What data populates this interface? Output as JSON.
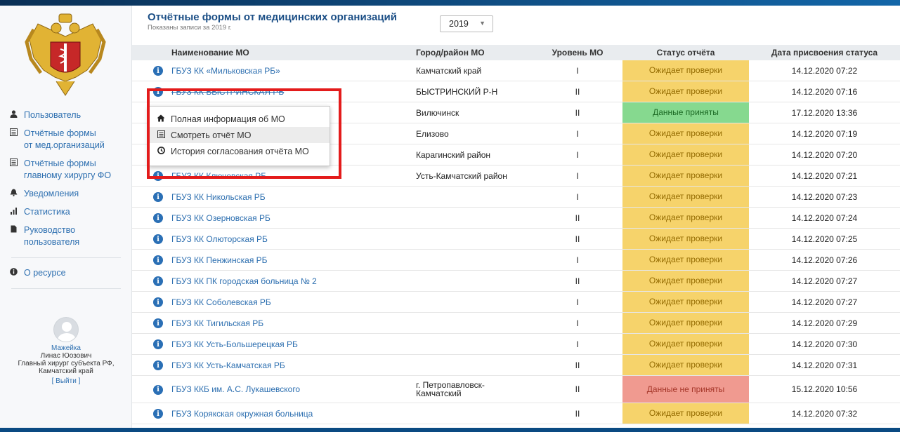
{
  "header": {
    "title": "Отчётные формы от медицинских организаций",
    "subtitle": "Показаны записи за 2019 г.",
    "year": "2019"
  },
  "sidebar": {
    "items": [
      {
        "label": "Пользователь",
        "icon": "user-icon"
      },
      {
        "label": "Отчётные формы\nот мед.организаций",
        "icon": "list-icon"
      },
      {
        "label": "Отчётные формы\nглавному хирургу ФО",
        "icon": "list-icon"
      },
      {
        "label": "Уведомления",
        "icon": "bell-icon"
      },
      {
        "label": "Статистика",
        "icon": "bar-chart-icon"
      },
      {
        "label": "Руководство\nпользователя",
        "icon": "file-icon"
      }
    ],
    "about": {
      "label": "О ресурсе",
      "icon": "info-icon"
    },
    "user": {
      "surname": "Мажейка",
      "given": "Линас Юозович",
      "role": "Главный хирург субъекта РФ,",
      "region": "Камчатский край",
      "logout": "[ Выйти ]"
    }
  },
  "table": {
    "columns": [
      "Наименование МО",
      "Город/район МО",
      "Уровень МО",
      "Статус отчёта",
      "Дата присвоения статуса"
    ],
    "rows": [
      {
        "name": "ГБУЗ КК «Мильковская РБ»",
        "city": "Камчатский край",
        "level": "I",
        "status": "Ожидает проверки",
        "st": "pending",
        "date": "14.12.2020 07:22"
      },
      {
        "name": "ГБУЗ КК БЫСТРИНСКАЯ РБ",
        "city": "БЫСТРИНСКИЙ Р-Н",
        "level": "II",
        "status": "Ожидает проверки",
        "st": "pending",
        "date": "14.12.2020 07:16"
      },
      {
        "name": "",
        "city": "Вилючинск",
        "level": "II",
        "status": "Данные приняты",
        "st": "ok",
        "date": "17.12.2020 13:36"
      },
      {
        "name": "",
        "city": "Елизово",
        "level": "I",
        "status": "Ожидает проверки",
        "st": "pending",
        "date": "14.12.2020 07:19"
      },
      {
        "name": "",
        "city": "Карагинский район",
        "level": "I",
        "status": "Ожидает проверки",
        "st": "pending",
        "date": "14.12.2020 07:20"
      },
      {
        "name": "ГБУЗ КК Ключевская РБ",
        "city": "Усть-Камчатский район",
        "level": "I",
        "status": "Ожидает проверки",
        "st": "pending",
        "date": "14.12.2020 07:21"
      },
      {
        "name": "ГБУЗ КК Никольская РБ",
        "city": "",
        "level": "I",
        "status": "Ожидает проверки",
        "st": "pending",
        "date": "14.12.2020 07:23"
      },
      {
        "name": "ГБУЗ КК Озерновская РБ",
        "city": "",
        "level": "II",
        "status": "Ожидает проверки",
        "st": "pending",
        "date": "14.12.2020 07:24"
      },
      {
        "name": "ГБУЗ КК Олюторская РБ",
        "city": "",
        "level": "II",
        "status": "Ожидает проверки",
        "st": "pending",
        "date": "14.12.2020 07:25"
      },
      {
        "name": "ГБУЗ КК Пенжинская РБ",
        "city": "",
        "level": "I",
        "status": "Ожидает проверки",
        "st": "pending",
        "date": "14.12.2020 07:26"
      },
      {
        "name": "ГБУЗ КК ПК городская больница № 2",
        "city": "",
        "level": "II",
        "status": "Ожидает проверки",
        "st": "pending",
        "date": "14.12.2020 07:27"
      },
      {
        "name": "ГБУЗ КК Соболевская РБ",
        "city": "",
        "level": "I",
        "status": "Ожидает проверки",
        "st": "pending",
        "date": "14.12.2020 07:27"
      },
      {
        "name": "ГБУЗ КК Тигильская РБ",
        "city": "",
        "level": "I",
        "status": "Ожидает проверки",
        "st": "pending",
        "date": "14.12.2020 07:29"
      },
      {
        "name": "ГБУЗ КК Усть-Большерецкая РБ",
        "city": "",
        "level": "I",
        "status": "Ожидает проверки",
        "st": "pending",
        "date": "14.12.2020 07:30"
      },
      {
        "name": "ГБУЗ КК Усть-Камчатская РБ",
        "city": "",
        "level": "II",
        "status": "Ожидает проверки",
        "st": "pending",
        "date": "14.12.2020 07:31"
      },
      {
        "name": "ГБУЗ ККБ им. А.С. Лукашевского",
        "city": "г. Петропавловск-\nКамчатский",
        "level": "II",
        "status": "Данные не приняты",
        "st": "rej",
        "date": "15.12.2020 10:56"
      },
      {
        "name": "ГБУЗ Корякская окружная больница",
        "city": "",
        "level": "II",
        "status": "Ожидает проверки",
        "st": "pending",
        "date": "14.12.2020 07:32"
      }
    ]
  },
  "context_menu": {
    "items": [
      {
        "label": "Полная информация об МО",
        "icon": "home-icon"
      },
      {
        "label": "Смотреть отчёт МО",
        "icon": "list-icon"
      },
      {
        "label": "История согласования отчёта МО",
        "icon": "clock-icon"
      }
    ]
  },
  "colors": {
    "pending": "#f6d36b",
    "accepted": "#86d98f",
    "rejected": "#f09a90",
    "accent": "#2d6fb0",
    "highlight": "#e31b1b"
  }
}
